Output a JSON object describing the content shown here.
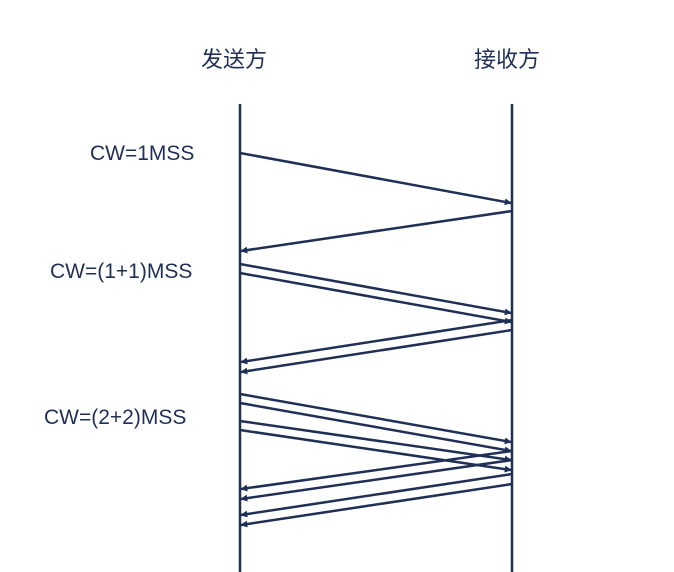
{
  "parties": {
    "sender": "发送方",
    "receiver": "接收方"
  },
  "cw_labels": [
    "CW=1MSS",
    "CW=(1+1)MSS",
    "CW=(2+2)MSS"
  ],
  "colors": {
    "line": "#1f2f55",
    "text": "#1f2f55",
    "background": "#ffffff"
  }
}
